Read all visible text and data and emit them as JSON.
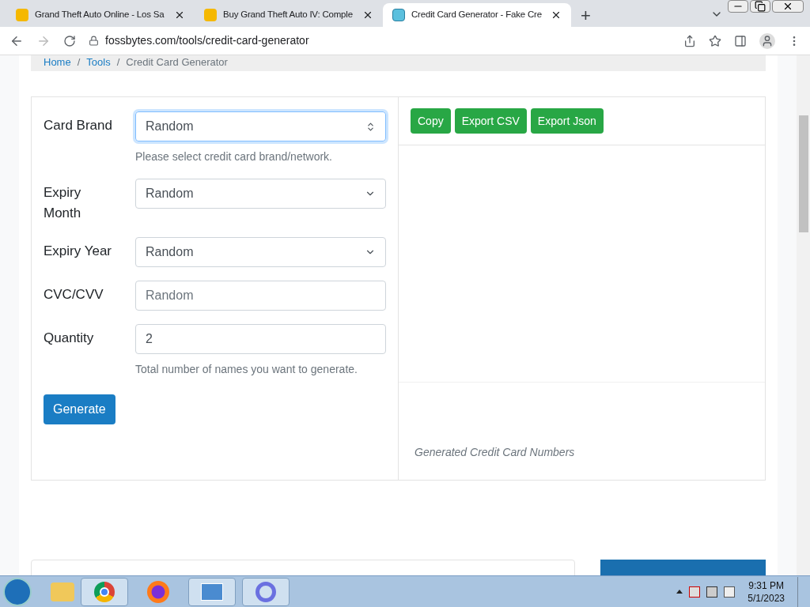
{
  "browser": {
    "tabs": [
      {
        "title": "Grand Theft Auto Online - Los Sa",
        "selected": false
      },
      {
        "title": "Buy Grand Theft Auto IV: Comple",
        "selected": false
      },
      {
        "title": "Credit Card Generator - Fake Cre",
        "selected": true
      }
    ],
    "new_tab": "+",
    "url": "fossbytes.com/tools/credit-card-generator"
  },
  "breadcrumb": {
    "items": [
      "Home",
      "Tools",
      "Credit Card Generator"
    ],
    "separator": "/"
  },
  "form": {
    "fields": [
      {
        "label": "Card Brand",
        "kind": "select",
        "value": "Random",
        "focused": true,
        "help": "Please select credit card brand/network."
      },
      {
        "label": "Expiry Month",
        "kind": "select",
        "value": "Random",
        "focused": false
      },
      {
        "label": "Expiry Year",
        "kind": "select",
        "value": "Random",
        "focused": false
      },
      {
        "label": "CVC/CVV",
        "kind": "input",
        "placeholder": "Random",
        "focused": false
      },
      {
        "label": "Quantity",
        "kind": "input",
        "value": "2",
        "focused": false,
        "help": "Total number of names you want to generate."
      }
    ],
    "submit": "Generate"
  },
  "output": {
    "buttons": [
      "Copy",
      "Export CSV",
      "Export Json"
    ],
    "caption": "Generated Credit Card Numbers"
  },
  "taskbar": {
    "time": "9:31 PM",
    "date": "5/1/2023"
  }
}
